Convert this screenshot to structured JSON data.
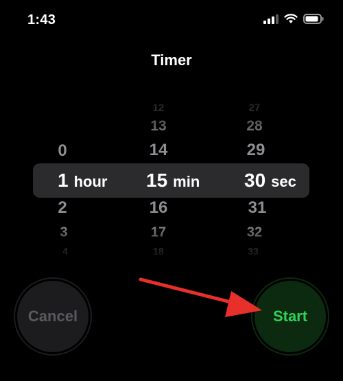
{
  "status_bar": {
    "time": "1:43",
    "colors": {
      "icons": "#ffffff"
    }
  },
  "title": "Timer",
  "picker": {
    "hours": {
      "above": [
        "0"
      ],
      "selected": "1",
      "below": [
        "2",
        "3",
        "4"
      ]
    },
    "minutes": {
      "above": [
        "12",
        "13",
        "14"
      ],
      "selected": "15",
      "below": [
        "16",
        "17",
        "18"
      ]
    },
    "seconds": {
      "above": [
        "27",
        "28",
        "29"
      ],
      "selected": "30",
      "below": [
        "31",
        "32",
        "33"
      ]
    },
    "unit_labels": {
      "hours": "hour",
      "minutes": "min",
      "seconds": "sec"
    }
  },
  "buttons": {
    "cancel": "Cancel",
    "start": "Start"
  },
  "colors": {
    "background": "#000000",
    "start_text": "#30d158",
    "start_bg": "#0b2a10",
    "cancel_text": "#5a5a5e",
    "cancel_bg": "#1c1c1e",
    "annotation_arrow": "#e8302b"
  }
}
